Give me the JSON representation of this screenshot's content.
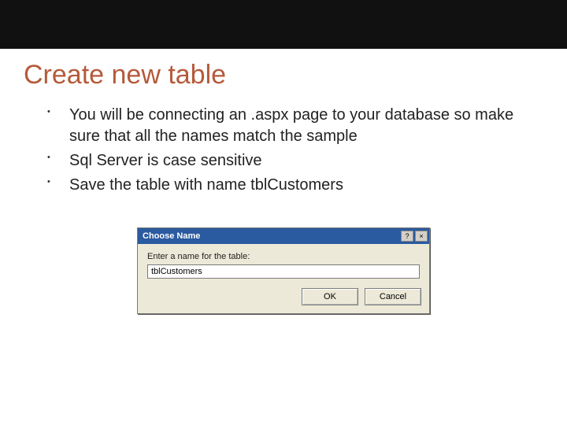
{
  "slide": {
    "title": "Create new table",
    "bullets": [
      "You will be connecting an .aspx page to your database so make sure that all the names match the sample",
      "Sql Server is case sensitive",
      "Save the table with name tblCustomers"
    ]
  },
  "dialog": {
    "title": "Choose Name",
    "help_icon_name": "help-icon",
    "close_icon_name": "close-icon",
    "help_glyph": "?",
    "close_glyph": "×",
    "prompt": "Enter a name for the table:",
    "input_value": "tblCustomers",
    "buttons": {
      "ok": "OK",
      "cancel": "Cancel"
    }
  }
}
